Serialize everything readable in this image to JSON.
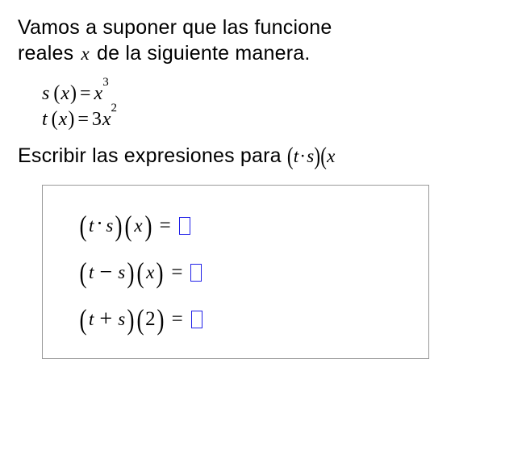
{
  "intro": {
    "line1_a": "Vamos a suponer que las funcione",
    "line2_a": "reales ",
    "line2_var": "x",
    "line2_b": " de la siguiente manera."
  },
  "defs": {
    "s": {
      "fn": "s",
      "arg": "x",
      "rhs_base": "x",
      "rhs_exp": "3"
    },
    "t": {
      "fn": "t",
      "arg": "x",
      "rhs_coef": "3",
      "rhs_base": "x",
      "rhs_exp": "2"
    }
  },
  "prompt": {
    "text": "Escribir las expresiones para ",
    "trail_t": "t",
    "trail_s": "s",
    "trail_x": "x"
  },
  "box": {
    "rows": [
      {
        "left": "t",
        "op": "dot",
        "right": "s",
        "arg": "x"
      },
      {
        "left": "t",
        "op": "minus",
        "right": "s",
        "arg": "x"
      },
      {
        "left": "t",
        "op": "plus",
        "right": "s",
        "arg": "2"
      }
    ],
    "glyphs": {
      "dot": "·",
      "minus": "−",
      "plus": "+"
    }
  }
}
